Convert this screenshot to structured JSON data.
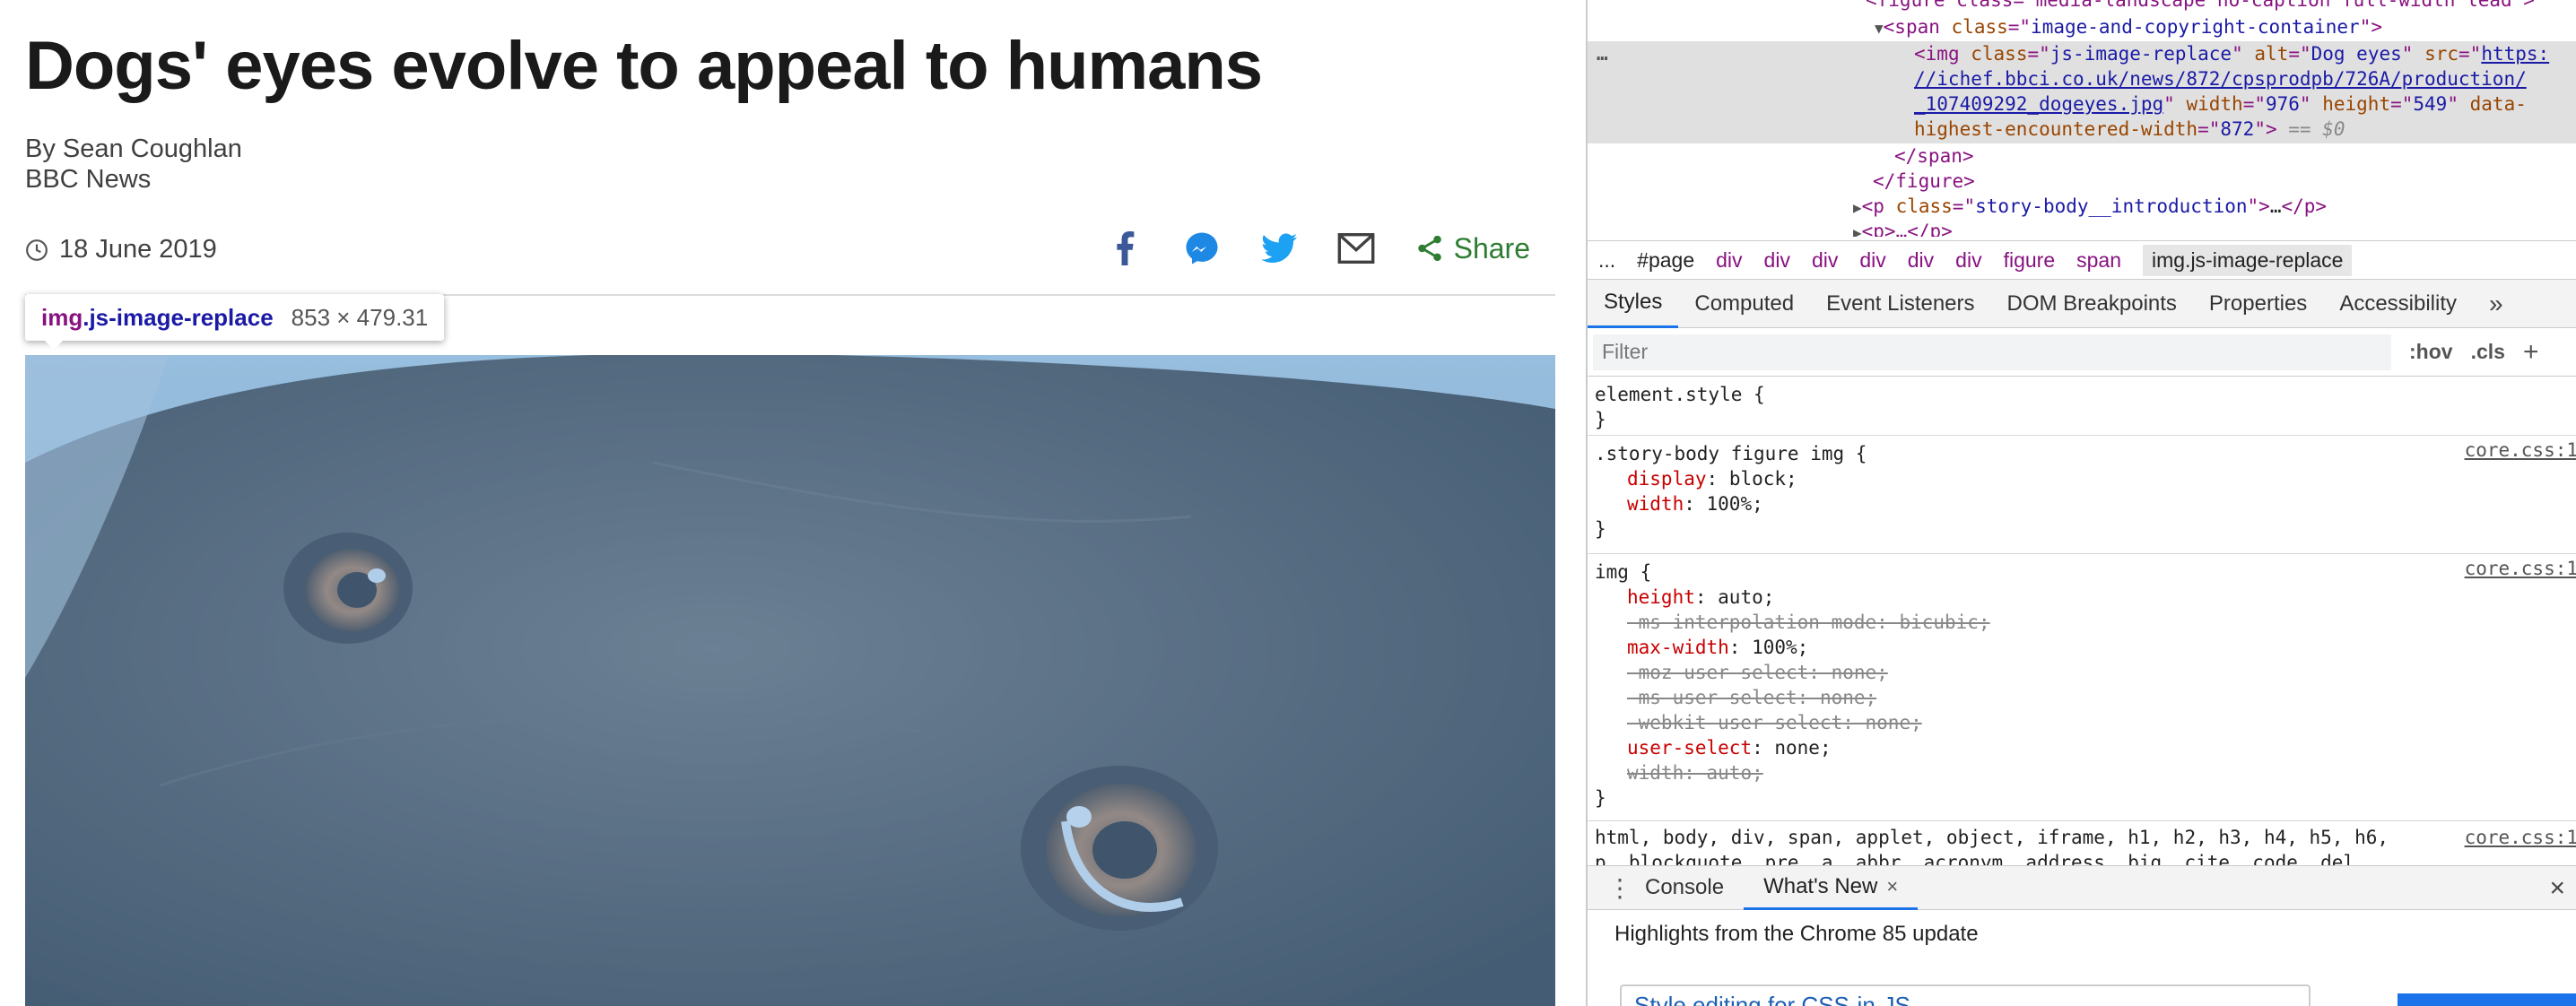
{
  "article": {
    "headline": "Dogs' eyes evolve to appeal to humans",
    "byline_author": "By Sean Coughlan",
    "byline_org": "BBC News",
    "date": "18 June 2019",
    "share_label": "Share",
    "image_alt": "Dog eyes"
  },
  "tooltip": {
    "tag": "img",
    "class": ".js-image-replace",
    "size": "853 × 479.31"
  },
  "devtools": {
    "tree": {
      "line0_text": "<figure class=\"media-landscape no-caption full-width lead\">",
      "line1_tag": "span",
      "line1_attr": "class",
      "line1_val": "image-and-copyright-container",
      "img_tag": "img",
      "img_class_val": "js-image-replace",
      "img_alt_val": "Dog eyes",
      "img_src_1": "https:",
      "img_src_2": "//ichef.bbci.co.uk/news/872/cpsprodpb/726A/production/",
      "img_src_3": "_107409292_dogeyes.jpg",
      "img_width_val": "976",
      "img_height_val": "549",
      "img_data_attr": "data-",
      "img_data_attr2": "highest-encountered-width",
      "img_data_val": "872",
      "img_eq": "== $0",
      "close_span": "</span>",
      "close_figure": "</figure>",
      "p_class_val": "story-body__introduction",
      "p_ellipsis": "…",
      "p_next": "<p>…</p>"
    },
    "breadcrumbs": [
      "...",
      "#page",
      "div",
      "div",
      "div",
      "div",
      "div",
      "div",
      "figure",
      "span",
      "img.js-image-replace"
    ],
    "style_tabs": [
      "Styles",
      "Computed",
      "Event Listeners",
      "DOM Breakpoints",
      "Properties",
      "Accessibility"
    ],
    "style_tabs_more": "»",
    "filter_placeholder": "Filter",
    "filter_tools": [
      ":hov",
      ".cls",
      "+"
    ],
    "rules": [
      {
        "selector": "element.style {",
        "source": "",
        "decls": []
      },
      {
        "selector": ".story-body figure img {",
        "source": "core.css:1",
        "decls": [
          {
            "name": "display",
            "value": "block;",
            "struck": false
          },
          {
            "name": "width",
            "value": "100%;",
            "struck": false
          }
        ]
      },
      {
        "selector": "img {",
        "source": "core.css:1",
        "decls": [
          {
            "name": "height",
            "value": "auto;",
            "struck": false
          },
          {
            "name": "-ms-interpolation-mode",
            "value": "bicubic;",
            "struck": true
          },
          {
            "name": "max-width",
            "value": "100%;",
            "struck": false
          },
          {
            "name": "-moz-user-select",
            "value": "none;",
            "struck": true
          },
          {
            "name": "-ms-user-select",
            "value": "none;",
            "struck": true
          },
          {
            "name": "-webkit-user-select",
            "value": "none;",
            "struck": true
          },
          {
            "name": "user-select",
            "value": "none;",
            "struck": false
          },
          {
            "name": "width",
            "value": "auto;",
            "struck": true
          }
        ]
      },
      {
        "selector": "html, body, div, span, applet, object, iframe, h1, h2, h3, h4, h5, h6,",
        "source": "core.css:1",
        "decls": []
      }
    ],
    "rule_tail": "p, blockquote, pre, a, abbr, acronym, address, big, cite, code, del,",
    "drawer_tabs": [
      "Console",
      "What's New"
    ],
    "drawer_tab_close": "×",
    "drawer_close": "×",
    "whatsnew_heading": "Highlights from the Chrome 85 update",
    "whatsnew_card": "Style editing for CSS-in-JS"
  },
  "icons": [
    "clock-icon",
    "facebook-icon",
    "messenger-icon",
    "twitter-icon",
    "email-icon",
    "share-icon"
  ],
  "colors": {
    "facebook": "#3b5998",
    "messenger": "#1e88e5",
    "twitter": "#1da1f2",
    "email": "#404040",
    "share": "#2e7d32",
    "highlight": "#6fa8dc",
    "devtools_accent": "#1a73e8"
  }
}
